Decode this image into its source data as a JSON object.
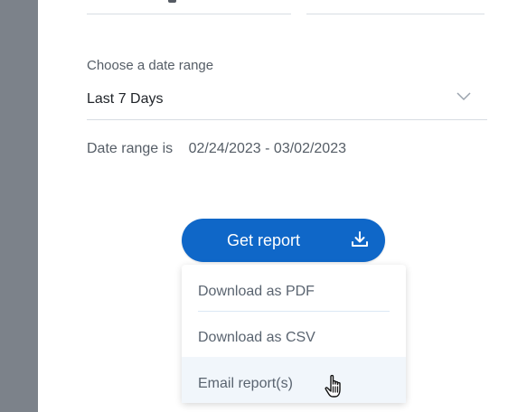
{
  "date_range_section": {
    "label": "Choose a date range",
    "selected_value": "Last 7 Days",
    "chevron_icon": "chevron-down-icon"
  },
  "date_range_summary": {
    "prefix": "Date range is",
    "range_value": "02/24/2023 - 03/02/2023"
  },
  "report_button": {
    "label": "Get report",
    "icon": "download-icon"
  },
  "report_menu": {
    "items": [
      {
        "label": "Download as PDF"
      },
      {
        "label": "Download as CSV"
      },
      {
        "label": "Email report(s)"
      }
    ]
  },
  "cursor": {
    "icon": "hand-pointer-icon"
  },
  "colors": {
    "accent": "#0f67c8",
    "left_rail": "#7c828a",
    "hover_bg": "#f1f6fb",
    "text_muted": "#555d66",
    "divider": "#d8dde3"
  }
}
